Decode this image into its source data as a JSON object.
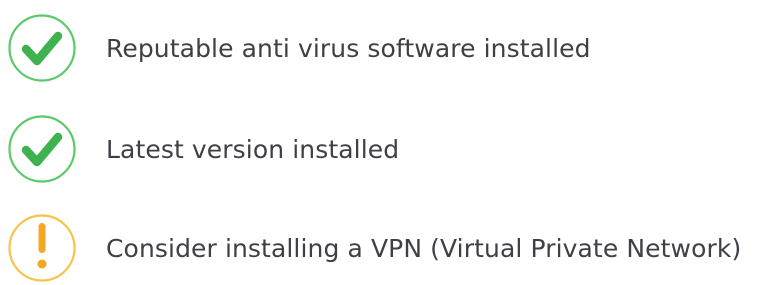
{
  "checklist": {
    "items": [
      {
        "status": "ok",
        "icon": "check-circle-icon",
        "label": "Reputable anti virus software installed"
      },
      {
        "status": "ok",
        "icon": "check-circle-icon",
        "label": "Latest version installed"
      },
      {
        "status": "warning",
        "icon": "exclamation-circle-icon",
        "label": "Consider installing a VPN (Virtual Private Network)"
      }
    ]
  },
  "colors": {
    "ok_ring": "#5cc96a",
    "ok_check": "#3fb14f",
    "warning_ring": "#f6c34b",
    "warning_mark": "#f5a623",
    "text": "#3f3f46"
  }
}
